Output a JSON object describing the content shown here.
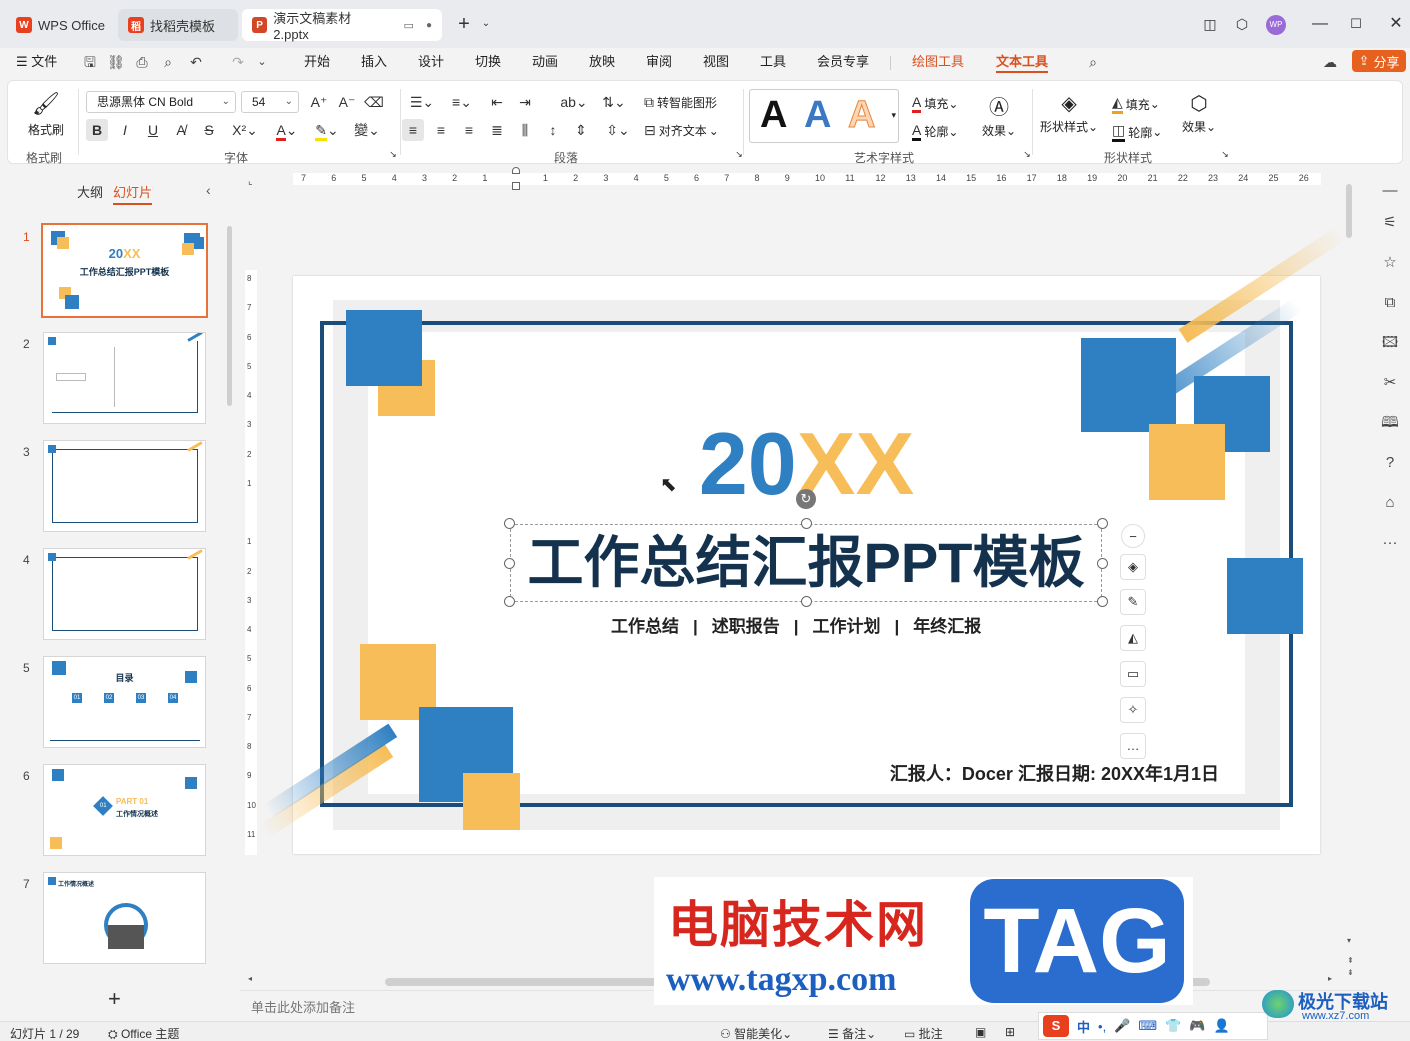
{
  "titlebar": {
    "tabs": [
      {
        "label": "WPS Office"
      },
      {
        "label": "找稻壳模板"
      },
      {
        "label": "演示文稿素材2.pptx"
      }
    ],
    "new_tab": "+",
    "avatar": "WP"
  },
  "menubar": {
    "file": "文件",
    "items": [
      "开始",
      "插入",
      "设计",
      "切换",
      "动画",
      "放映",
      "审阅",
      "视图",
      "工具",
      "会员专享"
    ],
    "context_tabs": [
      "绘图工具",
      "文本工具"
    ],
    "share": "分享"
  },
  "ribbon": {
    "format_painter": "格式刷",
    "group_format": "格式刷",
    "font_name": "思源黑体 CN Bold",
    "font_size": "54",
    "group_font": "字体",
    "smart_art": "转智能图形",
    "align_text": "对齐文本",
    "group_paragraph": "段落",
    "fill": "填充",
    "outline": "轮廓",
    "effect": "效果",
    "group_art": "艺术字样式",
    "shape_style": "形状样式",
    "fill2": "填充",
    "outline2": "轮廓",
    "effect2": "效果",
    "group_shape": "形状样式",
    "art_sample": "A"
  },
  "leftpanel": {
    "tab_outline": "大纲",
    "tab_slides": "幻灯片",
    "thumbs": [
      {
        "num": "1",
        "title": "20XX",
        "sub": "工作总结汇报PPT模板"
      },
      {
        "num": "2"
      },
      {
        "num": "3"
      },
      {
        "num": "4"
      },
      {
        "num": "5",
        "title": "目录",
        "items": [
          "01",
          "02",
          "03",
          "04"
        ]
      },
      {
        "num": "6",
        "title": "PART 01",
        "sub": "工作情况概述",
        "badge": "01"
      },
      {
        "num": "7",
        "title": "工作情况概述"
      }
    ],
    "add": "+"
  },
  "ruler": {
    "h_ticks": [
      "7",
      "6",
      "5",
      "4",
      "3",
      "2",
      "1",
      "",
      "1",
      "2",
      "3",
      "4",
      "5",
      "6",
      "7",
      "8",
      "9",
      "10",
      "11",
      "12",
      "13",
      "14",
      "15",
      "16",
      "17",
      "18",
      "19",
      "20",
      "21",
      "22",
      "23",
      "24",
      "25",
      "26"
    ],
    "v_ticks": [
      "8",
      "7",
      "6",
      "5",
      "4",
      "3",
      "2",
      "1",
      "",
      "1",
      "2",
      "3",
      "4",
      "5",
      "6",
      "7",
      "8",
      "9",
      "10",
      "11"
    ]
  },
  "slide": {
    "year_part1": "20",
    "year_part2": "XX",
    "title": "工作总结汇报PPT模板",
    "subtitles": [
      "工作总结",
      "述职报告",
      "工作计划",
      "年终汇报"
    ],
    "reporter": "汇报人：Docer  汇报日期: 20XX年1月1日",
    "colors": {
      "blue": "#2f80c2",
      "orange": "#f6bd58",
      "navy": "#1a4d7a"
    }
  },
  "notes": {
    "placeholder": "单击此处添加备注"
  },
  "status": {
    "slide_info": "幻灯片 1 / 29",
    "theme": "Office 主题",
    "beautify": "智能美化",
    "notes": "备注",
    "comments": "批注",
    "ime": "中"
  },
  "watermark": {
    "site_name": "电脑技术网",
    "url": "www.tagxp.com",
    "tag": "TAG",
    "corner": "极光下载站",
    "corner_url": "www.xz7.com"
  }
}
